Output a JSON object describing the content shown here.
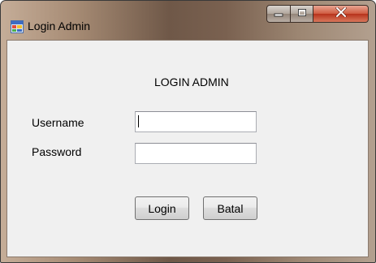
{
  "window": {
    "title": "Login Admin",
    "app_icon": "windows-form-icon",
    "caption_buttons": [
      "minimize-icon",
      "maximize-icon",
      "close-icon"
    ]
  },
  "form": {
    "heading": "LOGIN ADMIN",
    "username_label": "Username",
    "username_value": "",
    "password_label": "Password",
    "password_value": "",
    "login_button": "Login",
    "cancel_button": "Batal"
  }
}
